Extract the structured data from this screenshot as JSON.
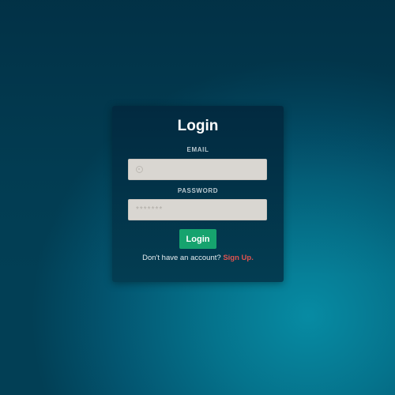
{
  "form": {
    "title": "Login",
    "email_label": "EMAIL",
    "email_value": "",
    "email_icon": "at-icon",
    "password_label": "PASSWORD",
    "password_placeholder": "*******",
    "submit_label": "Login",
    "signup_prompt": "Don't have an account?",
    "signup_link": "Sign Up."
  },
  "colors": {
    "background": "#05738c",
    "card": "#022f45",
    "field": "#d9d6d1",
    "submit": "#16a36e",
    "link": "#e0524f"
  }
}
